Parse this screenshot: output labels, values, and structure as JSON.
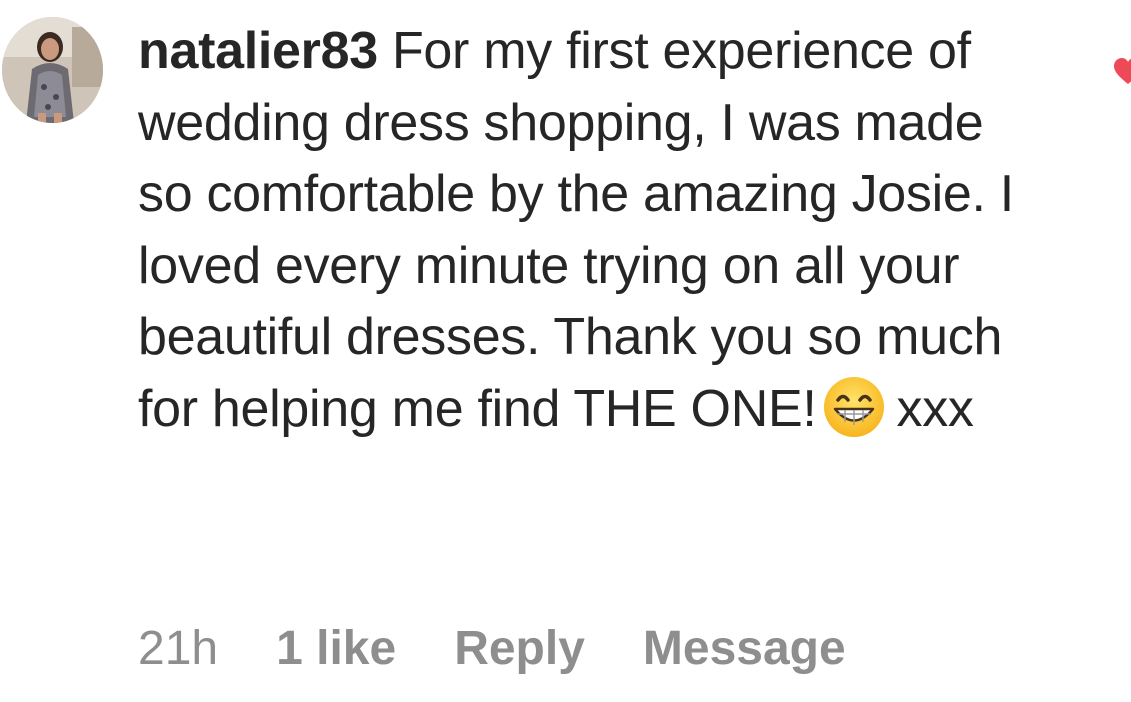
{
  "comment": {
    "username": "natalier83",
    "text_before_emoji": "For my first experience of wedding dress shopping, I was made so comfortable by the amazing Josie. I loved every minute trying on all your beautiful dresses. Thank you so much for helping me find THE ONE!",
    "emoji": "grinning-face-with-smiling-eyes",
    "text_after_emoji": "xxx",
    "timestamp": "21h",
    "likes": "1 like",
    "reply_label": "Reply",
    "message_label": "Message",
    "like_icon": "heart-icon",
    "like_icon_color": "#ed4956"
  },
  "colors": {
    "text": "#262626",
    "meta": "#8e8e8e",
    "background": "#ffffff"
  }
}
